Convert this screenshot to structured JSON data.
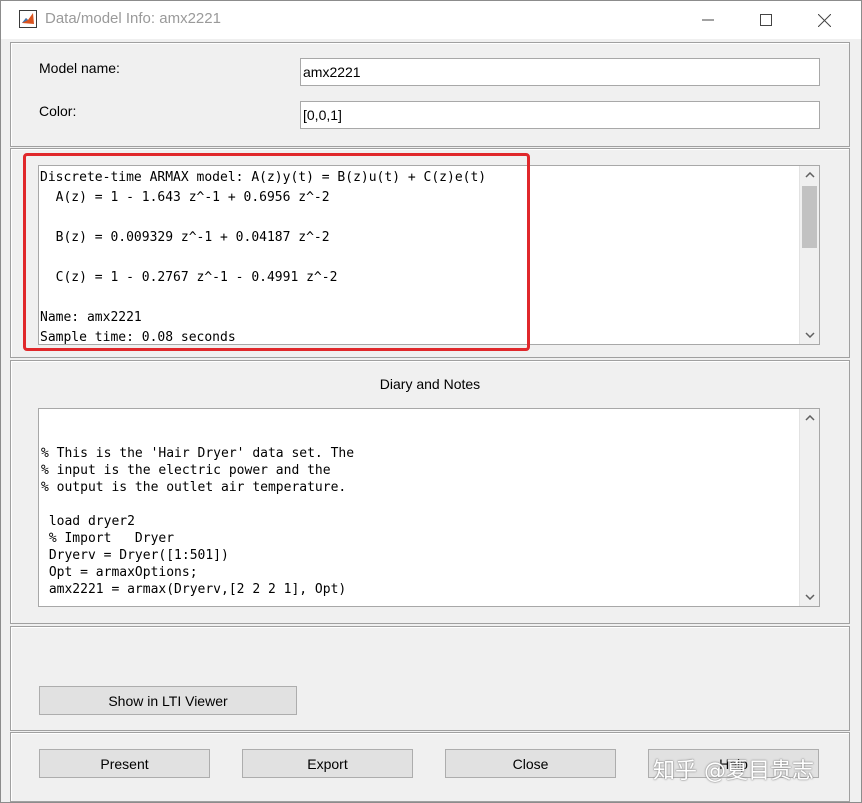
{
  "window": {
    "title": "Data/model Info: amx2221"
  },
  "model": {
    "name_label": "Model name:",
    "name_value": "amx2221",
    "color_label": "Color:",
    "color_value": "[0,0,1]"
  },
  "info": {
    "lines": [
      "Discrete-time ARMAX model: A(z)y(t) = B(z)u(t) + C(z)e(t)",
      "  A(z) = 1 - 1.643 z^-1 + 0.6956 z^-2",
      "",
      "  B(z) = 0.009329 z^-1 + 0.04187 z^-2",
      "",
      "  C(z) = 1 - 0.2767 z^-1 - 0.4991 z^-2",
      "",
      "Name: amx2221",
      "Sample time: 0.08 seconds"
    ]
  },
  "diary": {
    "title": "Diary and Notes",
    "lines": [
      "% This is the 'Hair Dryer' data set. The",
      "% input is the electric power and the",
      "% output is the outlet air temperature.",
      "",
      " load dryer2",
      " % Import   Dryer",
      " Dryerv = Dryer([1:501])",
      " Opt = armaxOptions;",
      " amx2221 = armax(Dryerv,[2 2 2 1], Opt)"
    ]
  },
  "buttons": {
    "lti_viewer": "Show in LTI Viewer",
    "present": "Present",
    "export": "Export",
    "close": "Close",
    "help": "Help"
  },
  "watermark": "知乎 @夏目贵志",
  "colors": {
    "highlight": "#e0282b",
    "panel_bg": "#f0f0f0",
    "button_bg": "#e1e1e1"
  }
}
